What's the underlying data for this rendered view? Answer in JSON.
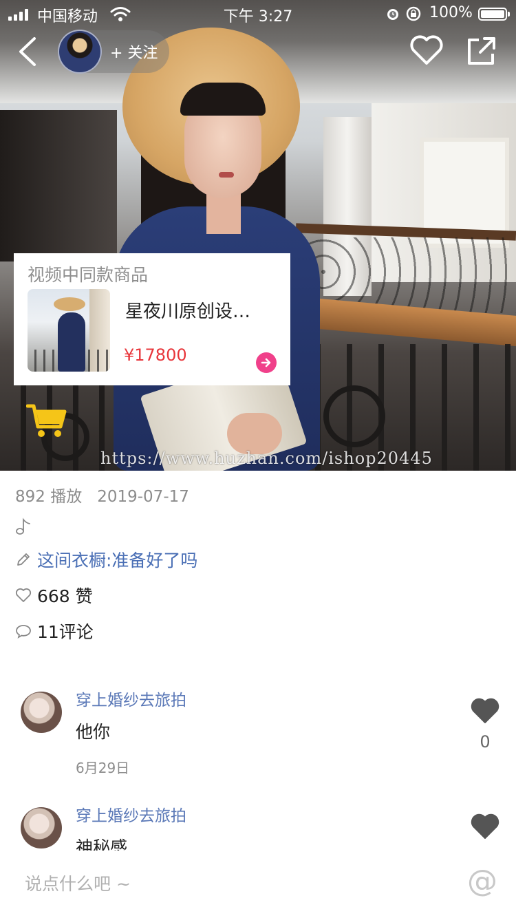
{
  "status_bar": {
    "carrier": "中国移动",
    "time": "下午 3:27",
    "battery_percent": "100%",
    "battery_level": 1.0
  },
  "top_nav": {
    "follow_label": "+ 关注",
    "icons": [
      "back-icon",
      "heart-outline-icon",
      "share-icon"
    ]
  },
  "video": {
    "watermark": "https://www.huzhan.com/ishop20445"
  },
  "product_card": {
    "title": "视频中同款商品",
    "name": "星夜川原创设…",
    "price": "¥17800"
  },
  "info": {
    "plays": "892 播放",
    "date": "2019-07-17",
    "topic": "这间衣橱:准备好了吗",
    "likes": "668 赞",
    "comments": "11评论"
  },
  "comments": [
    {
      "author": "穿上婚纱去旅拍",
      "text": "他你",
      "date": "6月29日",
      "likes": "0"
    },
    {
      "author": "穿上婚纱去旅拍",
      "text": "神秘感",
      "date": "",
      "likes": ""
    }
  ],
  "bottom_bar": {
    "placeholder": "说点什么吧 ~",
    "at_label": "@"
  },
  "colors": {
    "link_blue": "#4a6fb5",
    "name_blue": "#5a78b7",
    "price_red": "#e8353a",
    "arrow_pink": "#f0408a",
    "cart_yellow": "#f5c518"
  }
}
